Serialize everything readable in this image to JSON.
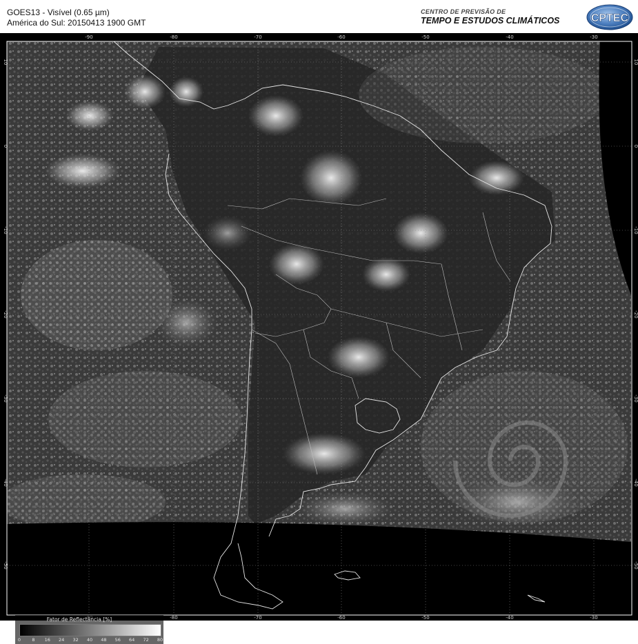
{
  "header": {
    "title_line1": "GOES13 - Visível (0.65 µm)",
    "title_line2": "América do Sul: 20150413 1900 GMT",
    "org_small": "CENTRO DE PREVISÃO DE",
    "org_big": "TEMPO E ESTUDOS CLIMÁTICOS",
    "logo_text": "CPTEC"
  },
  "map": {
    "lon_labels": [
      "-90",
      "-80",
      "-70",
      "-60",
      "-50",
      "-40",
      "-30"
    ],
    "lat_labels": [
      "10",
      "0",
      "-10",
      "-20",
      "-30",
      "-40",
      "-50"
    ],
    "colors": {
      "background": "#000000",
      "coastline": "#e8e8e8",
      "grid": "#8a8a8a",
      "frame": "#ffffff"
    }
  },
  "legend": {
    "title": "Fator de Reflectância [%]",
    "ticks": [
      "0",
      "8",
      "16",
      "24",
      "32",
      "40",
      "48",
      "56",
      "64",
      "72",
      "80"
    ]
  }
}
